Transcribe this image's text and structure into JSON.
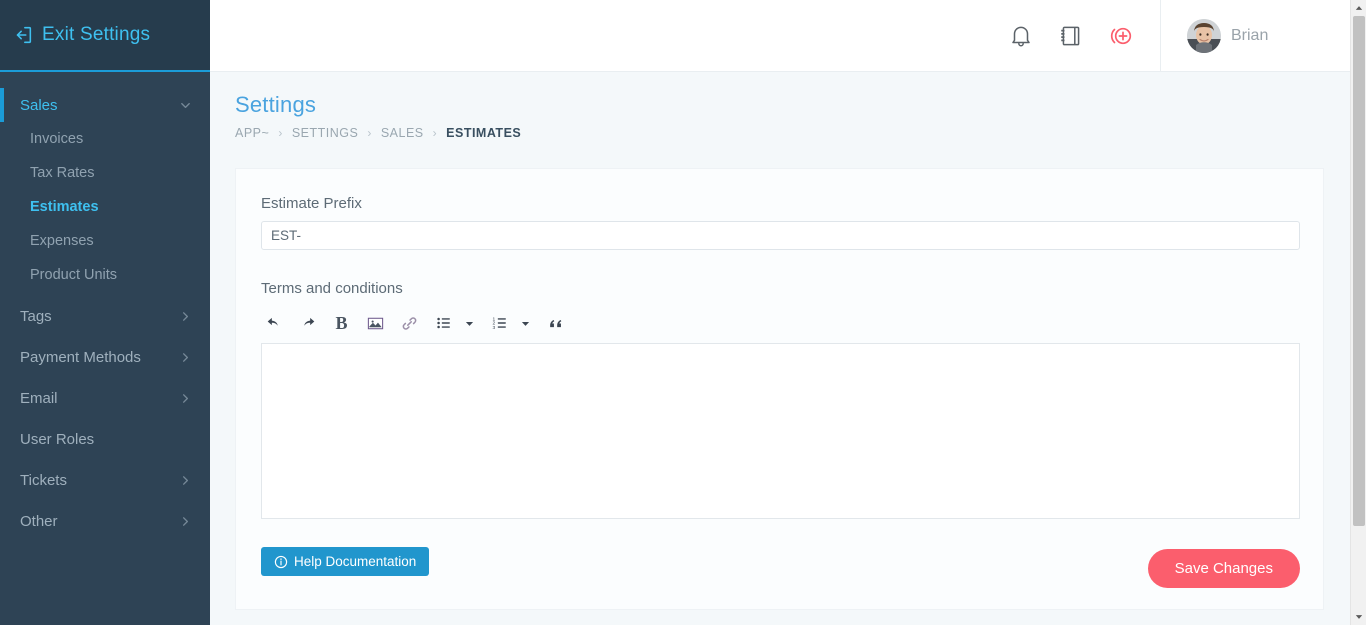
{
  "sidebar": {
    "exit_label": "Exit Settings",
    "exit_icon": "exit-arrow-icon",
    "items": [
      {
        "label": "Sales",
        "type": "group",
        "active": true,
        "expanded": true,
        "icon": "chevron-down-icon"
      },
      {
        "label": "Invoices",
        "type": "sub",
        "active": false
      },
      {
        "label": "Tax Rates",
        "type": "sub",
        "active": false
      },
      {
        "label": "Estimates",
        "type": "sub",
        "active": true
      },
      {
        "label": "Expenses",
        "type": "sub",
        "active": false
      },
      {
        "label": "Product Units",
        "type": "sub",
        "active": false
      },
      {
        "label": "Tags",
        "type": "group",
        "active": false,
        "expanded": false,
        "icon": "chevron-right-icon"
      },
      {
        "label": "Payment Methods",
        "type": "group",
        "active": false,
        "expanded": false,
        "icon": "chevron-right-icon"
      },
      {
        "label": "Email",
        "type": "group",
        "active": false,
        "expanded": false,
        "icon": "chevron-right-icon"
      },
      {
        "label": "User Roles",
        "type": "group",
        "active": false,
        "expanded": false,
        "icon": "none"
      },
      {
        "label": "Tickets",
        "type": "group",
        "active": false,
        "expanded": false,
        "icon": "chevron-right-icon"
      },
      {
        "label": "Other",
        "type": "group",
        "active": false,
        "expanded": false,
        "icon": "chevron-right-icon"
      }
    ]
  },
  "topbar": {
    "icons": [
      {
        "name": "notifications-bell-icon"
      },
      {
        "name": "notebook-icon"
      },
      {
        "name": "quick-add-circle-plus-icon"
      }
    ],
    "user_name": "Brian",
    "avatar_name": "user-avatar"
  },
  "page": {
    "title": "Settings",
    "breadcrumb": [
      {
        "label": "APP~",
        "current": false
      },
      {
        "label": "SETTINGS",
        "current": false
      },
      {
        "label": "SALES",
        "current": false
      },
      {
        "label": "ESTIMATES",
        "current": true
      }
    ],
    "breadcrumb_separator": "›"
  },
  "form": {
    "prefix_label": "Estimate Prefix",
    "prefix_value": "EST-",
    "prefix_placeholder": "EST-",
    "terms_label": "Terms and conditions",
    "terms_value": "",
    "terms_placeholder": ""
  },
  "editor_toolbar": {
    "tools": [
      {
        "name": "undo-icon",
        "label": ""
      },
      {
        "name": "redo-icon",
        "label": ""
      },
      {
        "name": "bold-icon",
        "label": "B"
      },
      {
        "name": "insert-image-icon",
        "label": ""
      },
      {
        "name": "insert-link-icon",
        "label": ""
      },
      {
        "name": "bullet-list-icon",
        "label": ""
      },
      {
        "name": "bullet-list-caret-icon",
        "label": ""
      },
      {
        "name": "numbered-list-icon",
        "label": ""
      },
      {
        "name": "numbered-list-caret-icon",
        "label": ""
      },
      {
        "name": "blockquote-icon",
        "label": "“"
      }
    ]
  },
  "buttons": {
    "help_label": "Help Documentation",
    "help_icon": "info-circle-icon",
    "save_label": "Save Changes"
  },
  "colors": {
    "sidebar_bg": "#2e4355",
    "sidebar_header_bg": "#263c4d",
    "accent_cyan": "#3ec0f0",
    "accent_blue": "#1b9cd8",
    "page_title_blue": "#4aa3df",
    "help_button_blue": "#2196cd",
    "save_button_pink": "#fb5e6d",
    "content_bg": "#f4f8fa",
    "card_bg": "#fbfdfe"
  },
  "scrollbar": {
    "up_arrow": "scroll-up-arrow",
    "down_arrow": "scroll-down-arrow",
    "thumb": "scroll-thumb"
  }
}
